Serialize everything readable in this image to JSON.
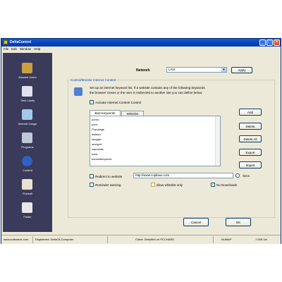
{
  "window": {
    "title": "DeltaControl",
    "minimize": "_",
    "maximize": "□",
    "close": "✕"
  },
  "menu": [
    "File",
    "Edit",
    "Window",
    "Help"
  ],
  "sidebar": {
    "items": [
      {
        "label": "Allowed Users",
        "icon": "users-icon",
        "color": "#c8a040"
      },
      {
        "label": "Time Limits",
        "icon": "clock-icon",
        "color": "#e0e0f0"
      },
      {
        "label": "Internet Usage",
        "icon": "computer-icon",
        "color": "#a0c8e8"
      },
      {
        "label": "Programs",
        "icon": "gears-icon",
        "color": "#c0c8d8"
      },
      {
        "label": "Content",
        "icon": "globe-icon",
        "color": "#3060c0"
      },
      {
        "label": "Firewall",
        "icon": "firewall-icon",
        "color": "#e8e0d0"
      },
      {
        "label": "Folder",
        "icon": "folder-icon",
        "color": "#e8e8e8"
      }
    ],
    "scroll_glyph": "▾"
  },
  "network": {
    "label": "Network",
    "value": "LAN",
    "apply_label": "Apply"
  },
  "group": {
    "title": "Control/Monitor Internet Content",
    "description_line1": "Set up an internet keyword list. If a website contains any of the following keywords",
    "description_line2": "the browser closes or the user is redirected to another site you can define below.",
    "enable_label": "Activate Internet Content Control"
  },
  "tabs": [
    "Bad Keywords",
    "Whitelist"
  ],
  "keywords": [
    "porno",
    "porn",
    "Pornstage",
    "lesbian",
    "sexygirl",
    "sextypirl",
    "warezsite",
    "hack",
    "bannedkeyword"
  ],
  "buttons": {
    "add": "Add",
    "delete": "Delete",
    "delete_all": "Delete All",
    "export": "Export",
    "import": "Import"
  },
  "options": {
    "redirect_label": "Redirect to website",
    "redirect_url": "http://www.copilaus.com",
    "secs_label": "Secs",
    "reporting_label": "Reminder warning",
    "whitelist_only_label": "allow whitelist only",
    "no_downloads_label": "No Downloads"
  },
  "footer": {
    "cancel": "Cancel",
    "ok": "OK"
  },
  "status": {
    "left": "www.softwarez.com",
    "registered": "Registered: DeltaTA Computer",
    "center": "Client: DeltaWin on PCCHARD",
    "right1": "NUMAP",
    "right2": "7.00E.0ct"
  }
}
